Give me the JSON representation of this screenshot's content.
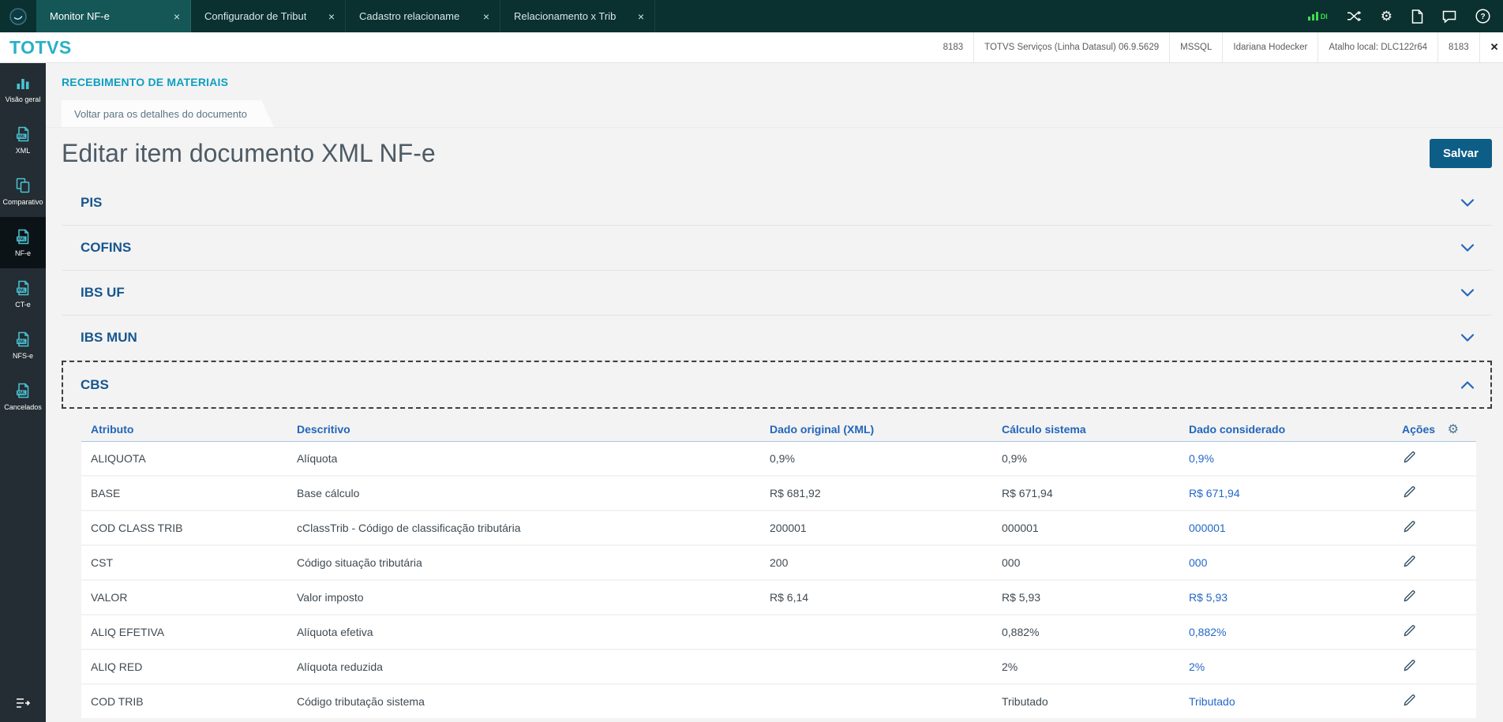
{
  "topbar": {
    "tabs": [
      {
        "label": "Monitor NF-e",
        "active": true
      },
      {
        "label": "Configurador de Tribut",
        "active": false
      },
      {
        "label": "Cadastro relacioname",
        "active": false
      },
      {
        "label": "Relacionamento x Trib",
        "active": false
      }
    ],
    "di_label": "DI"
  },
  "icons": {
    "gear": "⚙",
    "close": "×",
    "exit_x": "✕"
  },
  "brandbar": {
    "brand": "TOTVS",
    "env_items": [
      "8183",
      "TOTVS Serviços (Linha Datasul) 06.9.5629",
      "MSSQL",
      "Idariana Hodecker",
      "Atalho local: DLC122r64",
      "8183"
    ],
    "exit_label": "Sair"
  },
  "sidebar": {
    "items": [
      {
        "label": "Visão geral",
        "icon": "bar-chart-icon",
        "active": false
      },
      {
        "label": "XML",
        "icon": "xml-doc-icon",
        "active": false
      },
      {
        "label": "Comparativo",
        "icon": "compare-icon",
        "active": false
      },
      {
        "label": "NF-e",
        "icon": "xml-doc-icon",
        "active": true
      },
      {
        "label": "CT-e",
        "icon": "xml-doc-icon",
        "active": false
      },
      {
        "label": "NFS-e",
        "icon": "xml-doc-icon",
        "active": false
      },
      {
        "label": "Cancelados",
        "icon": "xml-doc-icon",
        "active": false
      }
    ]
  },
  "main": {
    "section_title": "RECEBIMENTO DE MATERIAIS",
    "back_tab_label": "Voltar para os detalhes do documento",
    "page_title": "Editar item documento XML NF-e",
    "save_label": "Salvar",
    "accordion_sections": [
      "PIS",
      "COFINS",
      "IBS UF",
      "IBS MUN"
    ],
    "expanded_section": "CBS",
    "table": {
      "headers": [
        "Atributo",
        "Descritivo",
        "Dado original (XML)",
        "Cálculo sistema",
        "Dado considerado",
        "Ações"
      ],
      "rows": [
        {
          "attr": "ALIQUOTA",
          "desc": "Alíquota",
          "original": "0,9%",
          "system": "0,9%",
          "considered": "0,9%"
        },
        {
          "attr": "BASE",
          "desc": "Base cálculo",
          "original": "R$ 681,92",
          "system": "R$ 671,94",
          "considered": "R$ 671,94"
        },
        {
          "attr": "COD CLASS TRIB",
          "desc": "cClassTrib - Código de classificação tributária",
          "original": "200001",
          "system": "000001",
          "considered": "000001"
        },
        {
          "attr": "CST",
          "desc": "Código situação tributária",
          "original": "200",
          "system": "000",
          "considered": "000"
        },
        {
          "attr": "VALOR",
          "desc": "Valor imposto",
          "original": "R$ 6,14",
          "system": "R$ 5,93",
          "considered": "R$ 5,93"
        },
        {
          "attr": "ALIQ EFETIVA",
          "desc": "Alíquota efetiva",
          "original": "",
          "system": "0,882%",
          "considered": "0,882%"
        },
        {
          "attr": "ALIQ RED",
          "desc": "Alíquota reduzida",
          "original": "",
          "system": "2%",
          "considered": "2%"
        },
        {
          "attr": "COD TRIB",
          "desc": "Código tributação sistema",
          "original": "",
          "system": "Tributado",
          "considered": "Tributado"
        }
      ]
    }
  },
  "colors": {
    "topbar_bg": "#0b3030",
    "brand_teal": "#29b0c6",
    "accent_blue": "#2265bb",
    "link_blue": "#2468c8",
    "save_button": "#0d5e87",
    "signal_green": "#3ddc4e"
  }
}
